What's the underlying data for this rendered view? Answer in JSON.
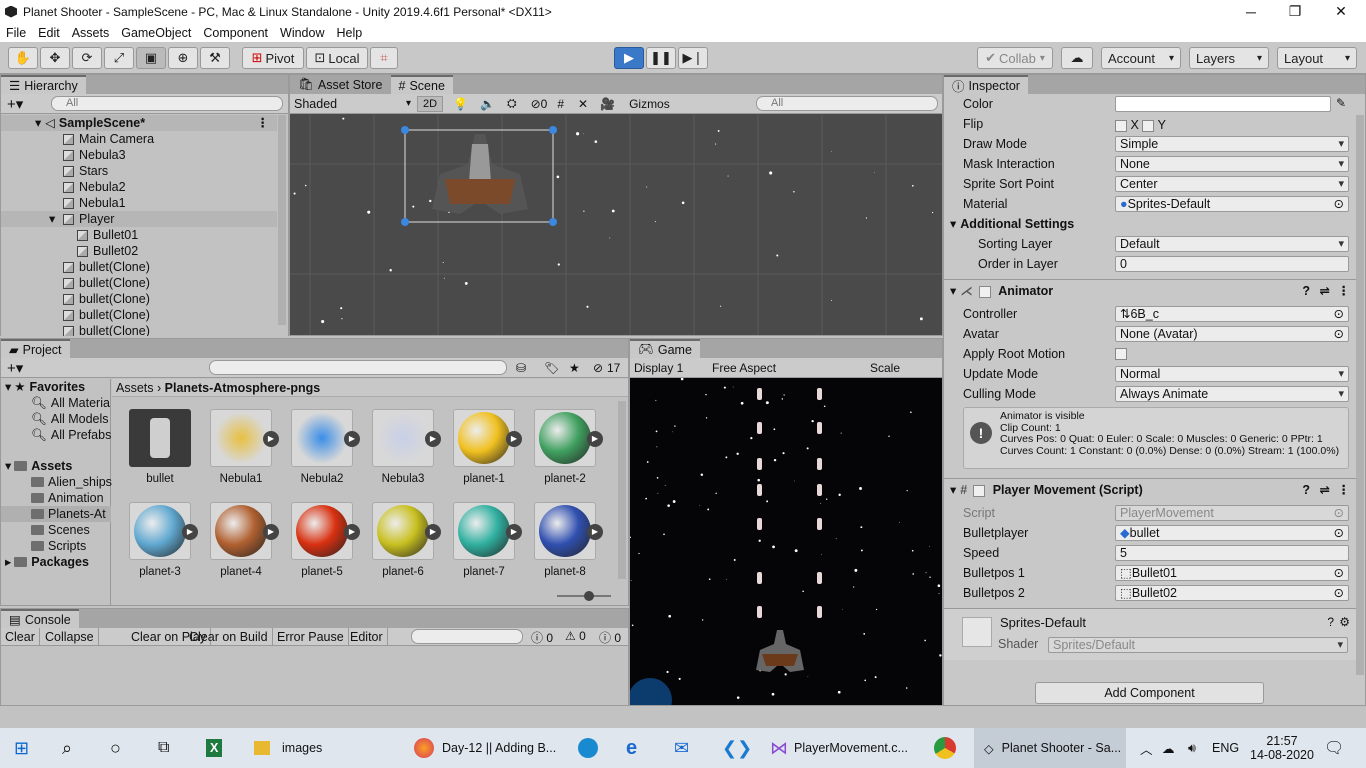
{
  "window": {
    "title": "Planet Shooter - SampleScene - PC, Mac & Linux Standalone - Unity 2019.4.6f1 Personal* <DX11>",
    "min": "─",
    "restore": "❐",
    "close": "✕"
  },
  "menu": [
    "File",
    "Edit",
    "Assets",
    "GameObject",
    "Component",
    "Window",
    "Help"
  ],
  "toolbar": {
    "pivot": "Pivot",
    "local": "Local",
    "collab": "Collab",
    "account": "Account",
    "layers": "Layers",
    "layout": "Layout"
  },
  "hierarchy": {
    "tab": "Hierarchy",
    "search_placeholder": "All",
    "scene": "SampleScene*",
    "items": [
      {
        "label": "Main Camera",
        "indent": 1
      },
      {
        "label": "Nebula3",
        "indent": 1
      },
      {
        "label": "Stars",
        "indent": 1
      },
      {
        "label": "Nebula2",
        "indent": 1
      },
      {
        "label": "Nebula1",
        "indent": 1
      },
      {
        "label": "Player",
        "indent": 1
      },
      {
        "label": "Bullet01",
        "indent": 2
      },
      {
        "label": "Bullet02",
        "indent": 2
      },
      {
        "label": "bullet(Clone)",
        "indent": 1
      },
      {
        "label": "bullet(Clone)",
        "indent": 1
      },
      {
        "label": "bullet(Clone)",
        "indent": 1
      },
      {
        "label": "bullet(Clone)",
        "indent": 1
      },
      {
        "label": "bullet(Clone)",
        "indent": 1
      }
    ]
  },
  "scene": {
    "tab_store": "Asset Store",
    "tab_scene": "Scene",
    "shading": "Shaded",
    "mode2d": "2D",
    "hidden_count": "0",
    "gizmos": "Gizmos",
    "search_placeholder": "All"
  },
  "project": {
    "tab": "Project",
    "count": "17",
    "breadcrumb_root": "Assets",
    "breadcrumb_sep": "›",
    "breadcrumb_leaf": "Planets-Atmosphere-pngs",
    "favorites": {
      "label": "Favorites",
      "items": [
        "All Materia",
        "All Models",
        "All Prefabs"
      ]
    },
    "assets": {
      "label": "Assets",
      "items": [
        "Alien_ships",
        "Animation",
        "Planets-At",
        "Scenes",
        "Scripts"
      ]
    },
    "packages": "Packages",
    "grid": [
      {
        "name": "bullet",
        "color": "#cfcfcf"
      },
      {
        "name": "Nebula1",
        "color": "#e8c040"
      },
      {
        "name": "Nebula2",
        "color": "#3a8ee8"
      },
      {
        "name": "Nebula3",
        "color": "#c8d0e8"
      },
      {
        "name": "planet-1",
        "color": "#f0c020"
      },
      {
        "name": "planet-2",
        "color": "#40a060"
      },
      {
        "name": "planet-3",
        "color": "#60a8d0"
      },
      {
        "name": "planet-4",
        "color": "#b06030"
      },
      {
        "name": "planet-5",
        "color": "#d83010"
      },
      {
        "name": "planet-6",
        "color": "#c8c020"
      },
      {
        "name": "planet-7",
        "color": "#30b0a0"
      },
      {
        "name": "planet-8",
        "color": "#3050b0"
      }
    ]
  },
  "console": {
    "tab": "Console",
    "buttons": [
      "Clear",
      "Collapse",
      "Clear on Play",
      "Clear on Build",
      "Error Pause",
      "Editor"
    ],
    "errors": "0",
    "warnings": "0",
    "infos": "0"
  },
  "game": {
    "tab": "Game",
    "display": "Display 1",
    "aspect": "Free Aspect",
    "scale": "Scale"
  },
  "inspector": {
    "tab": "Inspector",
    "sprite_rows": [
      {
        "label": "Color",
        "value": ""
      },
      {
        "label": "Flip",
        "value": ""
      },
      {
        "label": "Draw Mode",
        "value": "Simple"
      },
      {
        "label": "Mask Interaction",
        "value": "None"
      },
      {
        "label": "Sprite Sort Point",
        "value": "Center"
      },
      {
        "label": "Material",
        "value": "Sprites-Default"
      }
    ],
    "flip_x": "X",
    "flip_y": "Y",
    "additional": "Additional Settings",
    "sorting_layer": {
      "label": "Sorting Layer",
      "value": "Default"
    },
    "order": {
      "label": "Order in Layer",
      "value": "0"
    },
    "animator": {
      "title": "Animator",
      "controller": {
        "label": "Controller",
        "value": "6B_c"
      },
      "avatar": {
        "label": "Avatar",
        "value": "None (Avatar)"
      },
      "root_motion": "Apply Root Motion",
      "update": {
        "label": "Update Mode",
        "value": "Normal"
      },
      "culling": {
        "label": "Culling Mode",
        "value": "Always Animate"
      },
      "info": [
        "Animator is visible",
        "Clip Count: 1",
        "Curves Pos: 0 Quat: 0 Euler: 0 Scale: 0 Muscles: 0 Generic: 0 PPtr: 1",
        "Curves Count: 1 Constant: 0 (0.0%) Dense: 0 (0.0%) Stream: 1 (100.0%)"
      ]
    },
    "player_movement": {
      "title": "Player Movement (Script)",
      "rows": [
        {
          "label": "Script",
          "value": "PlayerMovement"
        },
        {
          "label": "Bulletplayer",
          "value": "bullet"
        },
        {
          "label": "Speed",
          "value": "5"
        },
        {
          "label": "Bulletpos 1",
          "value": "Bullet01"
        },
        {
          "label": "Bulletpos 2",
          "value": "Bullet02"
        }
      ]
    },
    "material": {
      "name": "Sprites-Default",
      "shader_label": "Shader",
      "shader": "Sprites/Default"
    },
    "add_component": "Add Component"
  },
  "taskbar": {
    "images": "images",
    "firefox": "Day-12 || Adding B...",
    "vs": "PlayerMovement.c...",
    "unity": "Planet Shooter - Sa...",
    "lang": "ENG",
    "time": "21:57",
    "date": "14-08-2020"
  }
}
